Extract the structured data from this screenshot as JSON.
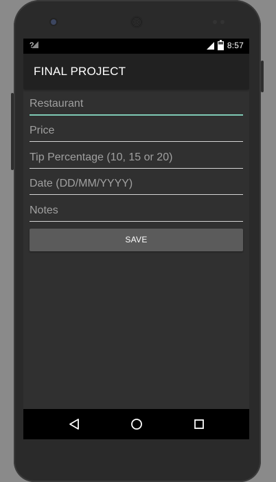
{
  "status_bar": {
    "left_indicator": "?",
    "time": "8:57"
  },
  "app_bar": {
    "title": "FINAL PROJECT"
  },
  "form": {
    "fields": [
      {
        "placeholder": "Restaurant",
        "value": ""
      },
      {
        "placeholder": "Price",
        "value": ""
      },
      {
        "placeholder": "Tip Percentage (10, 15 or 20)",
        "value": ""
      },
      {
        "placeholder": "Date (DD/MM/YYYY)",
        "value": ""
      },
      {
        "placeholder": "Notes",
        "value": ""
      }
    ],
    "save_label": "SAVE"
  },
  "navigation": {
    "icons": [
      "back-icon",
      "home-icon",
      "recents-icon"
    ]
  },
  "colors": {
    "accent": "#7fcbb6",
    "app_bar": "#212121",
    "background": "#303030",
    "button": "#5b5b5b"
  }
}
